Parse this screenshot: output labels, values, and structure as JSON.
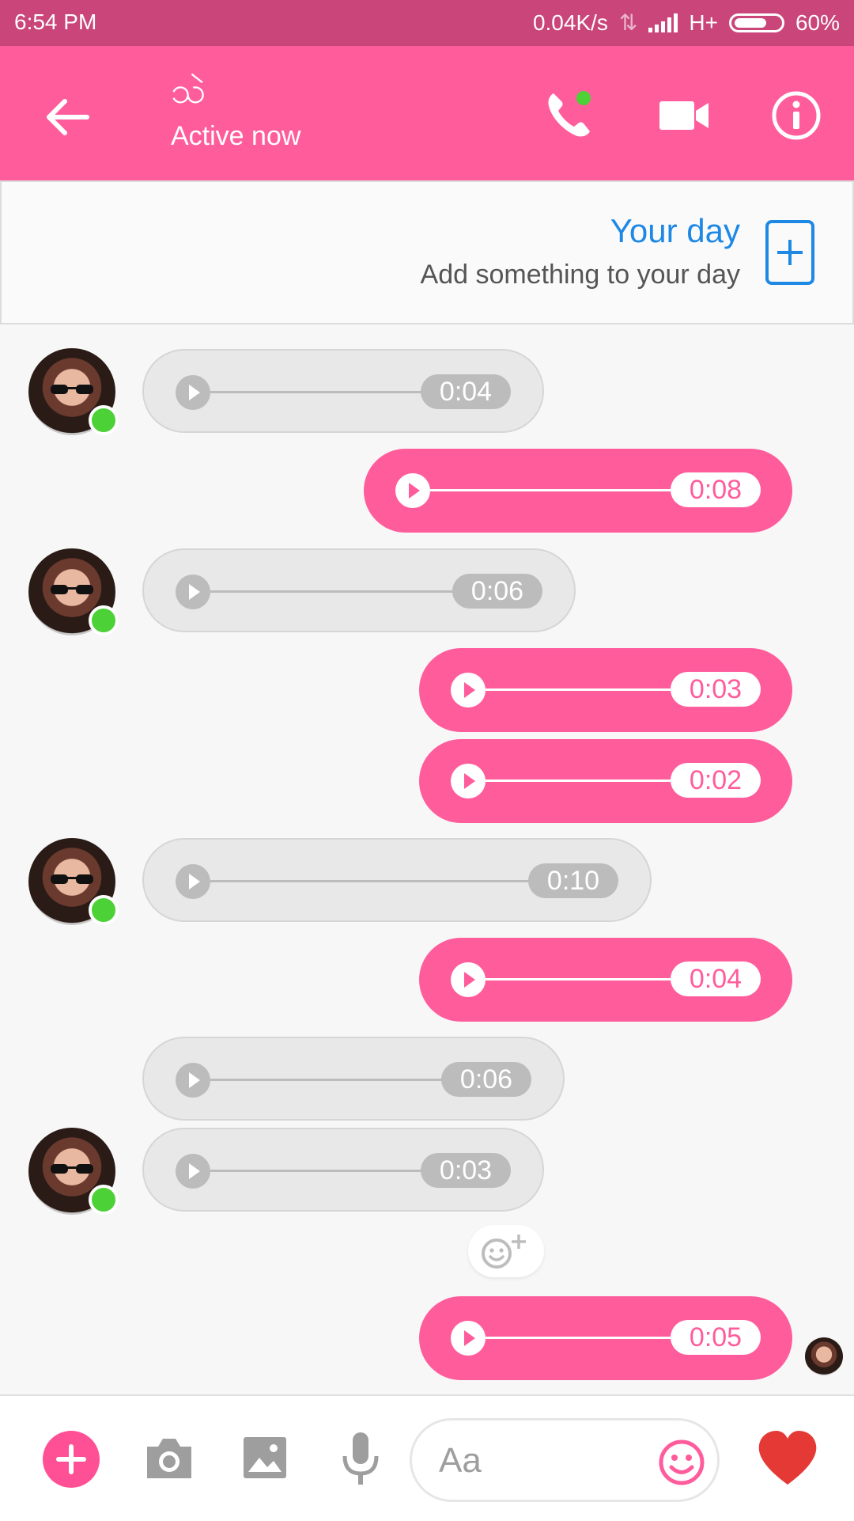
{
  "status_bar": {
    "time": "6:54 PM",
    "network_speed": "0.04K/s",
    "network_type": "H+",
    "battery": "60%"
  },
  "header": {
    "contact_name": "သဲ",
    "status": "Active now",
    "icons": [
      "back-arrow-icon",
      "phone-icon",
      "video-camera-icon",
      "info-icon"
    ],
    "accent": "#ff5c9c"
  },
  "your_day": {
    "title": "Your day",
    "subtitle": "Add something to your day"
  },
  "messages": [
    {
      "from": "them",
      "duration": "0:04"
    },
    {
      "from": "me",
      "duration": "0:08"
    },
    {
      "from": "them",
      "duration": "0:06"
    },
    {
      "from": "me",
      "duration": "0:03"
    },
    {
      "from": "me",
      "duration": "0:02"
    },
    {
      "from": "them",
      "duration": "0:10"
    },
    {
      "from": "me",
      "duration": "0:04"
    },
    {
      "from": "them",
      "duration": "0:06"
    },
    {
      "from": "them",
      "duration": "0:03"
    },
    {
      "from": "me",
      "duration": "0:05"
    }
  ],
  "composer": {
    "placeholder": "Aa",
    "icons": [
      "plus-icon",
      "camera-icon",
      "image-icon",
      "microphone-icon",
      "emoji-icon",
      "heart-icon"
    ]
  }
}
